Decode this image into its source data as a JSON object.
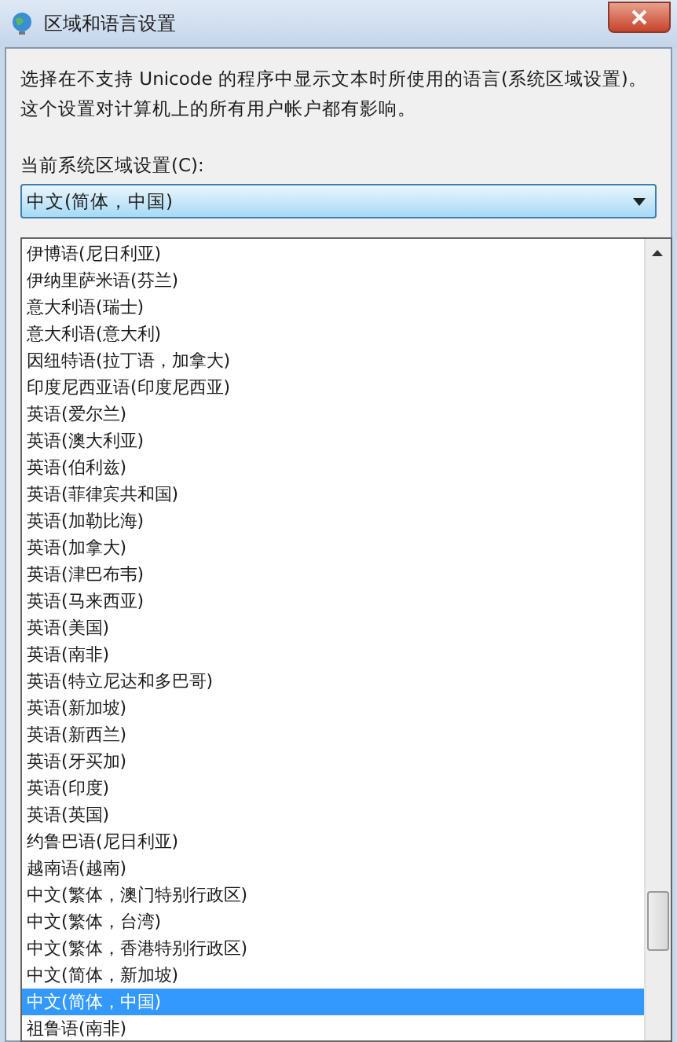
{
  "window": {
    "title": "区域和语言设置"
  },
  "description": "选择在不支持 Unicode 的程序中显示文本时所使用的语言(系统区域设置)。这个设置对计算机上的所有用户帐户都有影响。",
  "locale_label": "当前系统区域设置(C):",
  "locale_combo": {
    "value": "中文(简体，中国)",
    "expanded": true
  },
  "locale_options": [
    {
      "label": "伊博语(尼日利亚)",
      "selected": false
    },
    {
      "label": "伊纳里萨米语(芬兰)",
      "selected": false
    },
    {
      "label": "意大利语(瑞士)",
      "selected": false
    },
    {
      "label": "意大利语(意大利)",
      "selected": false
    },
    {
      "label": "因纽特语(拉丁语，加拿大)",
      "selected": false
    },
    {
      "label": "印度尼西亚语(印度尼西亚)",
      "selected": false
    },
    {
      "label": "英语(爱尔兰)",
      "selected": false
    },
    {
      "label": "英语(澳大利亚)",
      "selected": false
    },
    {
      "label": "英语(伯利兹)",
      "selected": false
    },
    {
      "label": "英语(菲律宾共和国)",
      "selected": false
    },
    {
      "label": "英语(加勒比海)",
      "selected": false
    },
    {
      "label": "英语(加拿大)",
      "selected": false
    },
    {
      "label": "英语(津巴布韦)",
      "selected": false
    },
    {
      "label": "英语(马来西亚)",
      "selected": false
    },
    {
      "label": "英语(美国)",
      "selected": false
    },
    {
      "label": "英语(南非)",
      "selected": false
    },
    {
      "label": "英语(特立尼达和多巴哥)",
      "selected": false
    },
    {
      "label": "英语(新加坡)",
      "selected": false
    },
    {
      "label": "英语(新西兰)",
      "selected": false
    },
    {
      "label": "英语(牙买加)",
      "selected": false
    },
    {
      "label": "英语(印度)",
      "selected": false
    },
    {
      "label": "英语(英国)",
      "selected": false
    },
    {
      "label": "约鲁巴语(尼日利亚)",
      "selected": false
    },
    {
      "label": "越南语(越南)",
      "selected": false
    },
    {
      "label": "中文(繁体，澳门特别行政区)",
      "selected": false
    },
    {
      "label": "中文(繁体，台湾)",
      "selected": false
    },
    {
      "label": "中文(繁体，香港特别行政区)",
      "selected": false
    },
    {
      "label": "中文(简体，新加坡)",
      "selected": false
    },
    {
      "label": "中文(简体，中国)",
      "selected": true
    },
    {
      "label": "祖鲁语(南非)",
      "selected": false
    }
  ]
}
